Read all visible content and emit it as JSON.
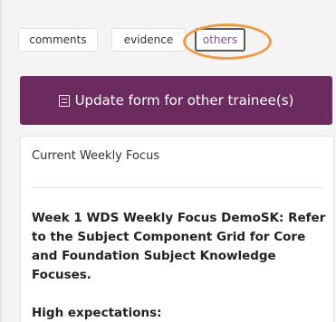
{
  "tabs": {
    "comments": "comments",
    "evidence": "evidence",
    "others": "others"
  },
  "update_button": {
    "label": "Update form for other trainee(s)",
    "icon": "document-list-icon"
  },
  "panel": {
    "title": "Current Weekly Focus",
    "focus_text": "Week 1 WDS Weekly Focus DemoSK: Refer to the Subject Component Grid for Core and Foundation Subject Knowledge Focuses.",
    "subheading": "High expectations:"
  },
  "colors": {
    "accent": "#6b2b5e",
    "highlight": "#ef9a49",
    "active_tab_text": "#8a4a9e"
  }
}
